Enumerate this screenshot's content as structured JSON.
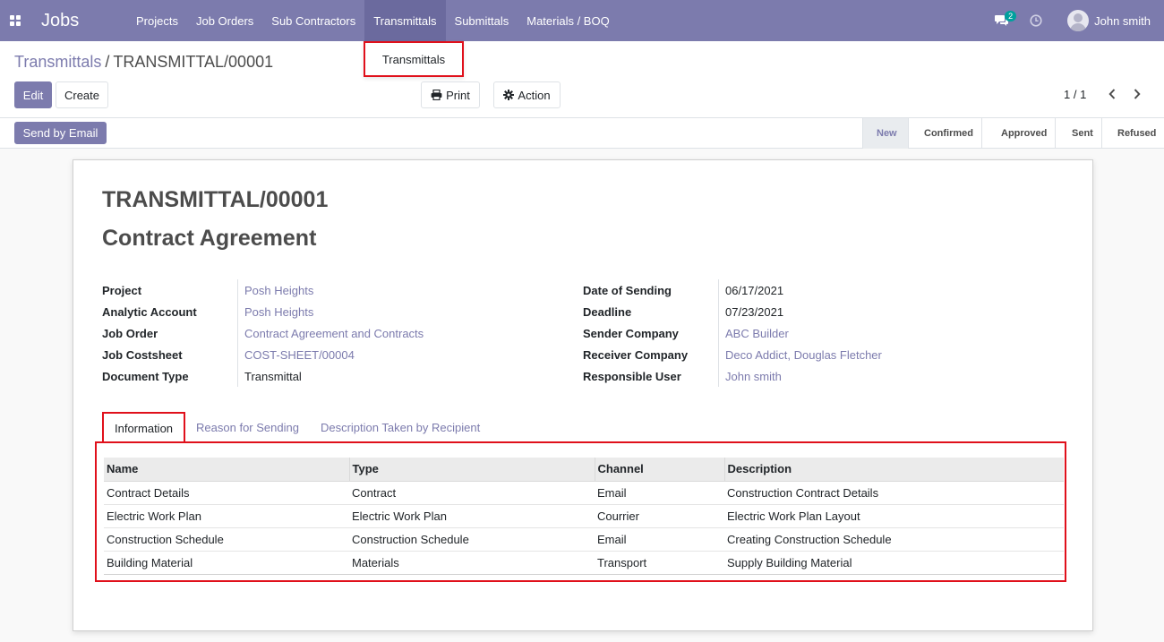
{
  "navbar": {
    "brand": "Jobs",
    "menu": [
      {
        "label": "Projects"
      },
      {
        "label": "Job Orders"
      },
      {
        "label": "Sub Contractors"
      },
      {
        "label": "Transmittals"
      },
      {
        "label": "Submittals"
      },
      {
        "label": "Materials / BOQ"
      }
    ],
    "active_menu": "Transmittals",
    "chat_count": "2",
    "user_name": "John smith",
    "colors": {
      "navbar": "#7c7bad",
      "highlight": "#e0101b"
    }
  },
  "dropdown": {
    "items": [
      "Transmittals"
    ]
  },
  "breadcrumb": {
    "parent": "Transmittals",
    "separator": "/",
    "current": "TRANSMITTAL/00001"
  },
  "buttons": {
    "edit": "Edit",
    "create": "Create",
    "print": "Print",
    "action": "Action",
    "send_by_email": "Send by Email"
  },
  "pager": {
    "value": "1 / 1"
  },
  "stages": [
    {
      "label": "New",
      "current": true
    },
    {
      "label": "Confirmed",
      "current": false
    },
    {
      "label": "Approved",
      "current": false
    },
    {
      "label": "Sent",
      "current": false
    },
    {
      "label": "Refused",
      "current": false
    }
  ],
  "form": {
    "name": "TRANSMITTAL/00001",
    "subject": "Contract Agreement",
    "left_fields": [
      {
        "label": "Project",
        "value": "Posh Heights",
        "link": true
      },
      {
        "label": "Analytic Account",
        "value": "Posh Heights",
        "link": true
      },
      {
        "label": "Job Order",
        "value": "Contract Agreement and Contracts",
        "link": true
      },
      {
        "label": "Job Costsheet",
        "value": "COST-SHEET/00004",
        "link": true
      },
      {
        "label": "Document Type",
        "value": "Transmittal",
        "link": false
      }
    ],
    "right_fields": [
      {
        "label": "Date of Sending",
        "value": "06/17/2021",
        "link": false
      },
      {
        "label": "Deadline",
        "value": "07/23/2021",
        "link": false
      },
      {
        "label": "Sender Company",
        "value": "ABC Builder",
        "link": true
      },
      {
        "label": "Receiver Company",
        "value": "Deco Addict, Douglas Fletcher",
        "link": true
      },
      {
        "label": "Responsible User",
        "value": "John smith",
        "link": true
      }
    ]
  },
  "tabs": [
    {
      "label": "Information",
      "active": true
    },
    {
      "label": "Reason for Sending",
      "active": false
    },
    {
      "label": "Description Taken by Recipient",
      "active": false
    }
  ],
  "table": {
    "columns": [
      "Name",
      "Type",
      "Channel",
      "Description"
    ],
    "rows": [
      [
        "Contract Details",
        "Contract",
        "Email",
        "Construction Contract Details"
      ],
      [
        "Electric Work Plan",
        "Electric Work Plan",
        "Courrier",
        "Electric Work Plan Layout"
      ],
      [
        "Construction Schedule",
        "Construction Schedule",
        "Email",
        "Creating Construction Schedule"
      ],
      [
        "Building Material",
        "Materials",
        "Transport",
        "Supply Building Material"
      ]
    ]
  }
}
